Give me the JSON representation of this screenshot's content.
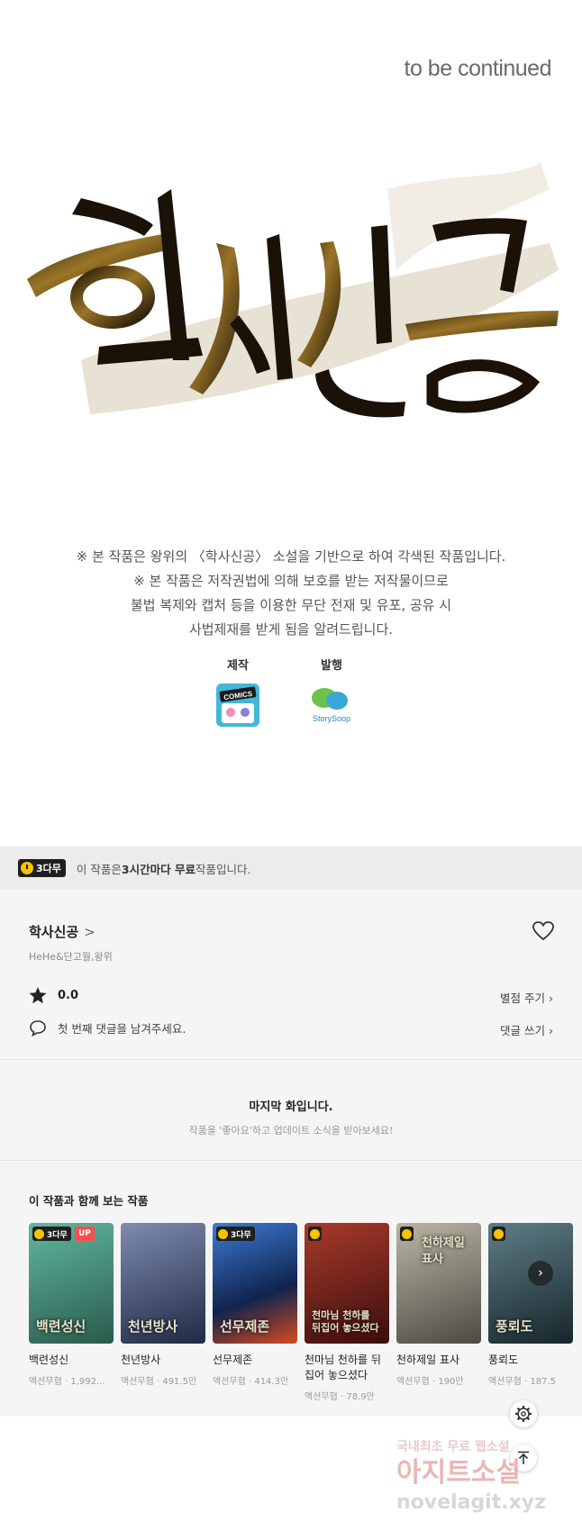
{
  "art": {
    "to_be_continued": "to be continued",
    "logo_text": "학사신공",
    "credit_lines": [
      "※ 본 작품은 왕위의 〈학사신공〉 소설을 기반으로 하여 각색된 작품입니다.",
      "※ 본 작품은 저작권법에 의해 보호를 받는 저작물이므로",
      "불법 복제와 캡처 등을 이용한 무단 전재 및 유포, 공유 시",
      "사법제재를 받게 됨을 알려드립니다."
    ],
    "production_label": "제작",
    "production_logo_text": "COMICS",
    "publisher_label": "발행",
    "publisher_logo_text": "StorySoop"
  },
  "notice": {
    "badge": "3다무",
    "text_pre": "이 작품은 ",
    "text_bold": "3시간마다 무료",
    "text_post": " 작품입니다."
  },
  "work": {
    "title": "학사신공",
    "authors": "HeHe&단고월,왕위",
    "rating": "0.0",
    "rate_link": "별점 주기",
    "comment_prompt": "첫 번째 댓글을 남겨주세요.",
    "comment_link": "댓글 쓰기"
  },
  "last_episode": {
    "title": "마지막 화입니다.",
    "subtitle": "작품을 '좋아요'하고 업데이트 소식을 받아보세요!"
  },
  "recommend": {
    "heading": "이 작품과 함께 보는 작품",
    "items": [
      {
        "name": "백련성신",
        "meta": "액션무협 · 1,992...",
        "badge": "3다무",
        "up": "UP",
        "cover_text": "백련성신",
        "color": "#3f8a7a"
      },
      {
        "name": "천년방사",
        "meta": "액션무협 · 491.5만",
        "badge": "",
        "up": "",
        "cover_text": "천년방사",
        "color": "#3a4a6e"
      },
      {
        "name": "선무제존",
        "meta": "액션무협 · 414.3만",
        "badge": "3다무",
        "up": "",
        "cover_text": "선무제존",
        "color": "#1e4f9a"
      },
      {
        "name": "천마님 천하를 뒤집어 놓으셨다",
        "meta": "액션무협 · 78.9만",
        "badge": "",
        "up": "",
        "cover_text": "천마님 천하를 뒤집어 놓으셨다",
        "color": "#6a2020"
      },
      {
        "name": "천하제일 표사",
        "meta": "액션무협 · 190만",
        "badge": "",
        "up": "",
        "cover_text": "천하제일 표사",
        "color": "#8a8a7e"
      },
      {
        "name": "풍뢰도",
        "meta": "액션무협 · 187.5",
        "badge": "",
        "up": "",
        "cover_text": "풍뢰도",
        "color": "#2f4a52"
      }
    ]
  },
  "watermark": {
    "line1": "국내최초 무료 웹소설",
    "line2": "아지트소설",
    "line3": "novelagit.xyz"
  },
  "colors": {
    "accent_yellow": "#f8c300",
    "up_red": "#ff4d4d",
    "panel_bg": "#f5f5f5"
  }
}
